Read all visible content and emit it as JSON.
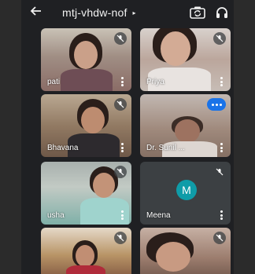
{
  "header": {
    "back_icon": "arrow-back-icon",
    "meeting_code": "mtj-vhdw-nof",
    "title_caret": "▸",
    "switch_camera_icon": "camera-switch-icon",
    "audio_output_icon": "headphones-icon"
  },
  "participants": [
    {
      "name": "pati",
      "status": "muted"
    },
    {
      "name": "Priya",
      "status": "muted"
    },
    {
      "name": "Bhavana",
      "status": "muted"
    },
    {
      "name": "Dr. Sunil ...",
      "status": "speaking"
    },
    {
      "name": "usha",
      "status": "muted"
    },
    {
      "name": "Meena",
      "status": "muted",
      "avatar_letter": "M",
      "avatar_color": "#0f9ca8"
    },
    {
      "name": "",
      "status": "muted"
    },
    {
      "name": "",
      "status": "muted"
    }
  ],
  "colors": {
    "background": "#1f2023",
    "tile_empty": "#3c4043",
    "speaking_badge": "#1a73e8"
  }
}
